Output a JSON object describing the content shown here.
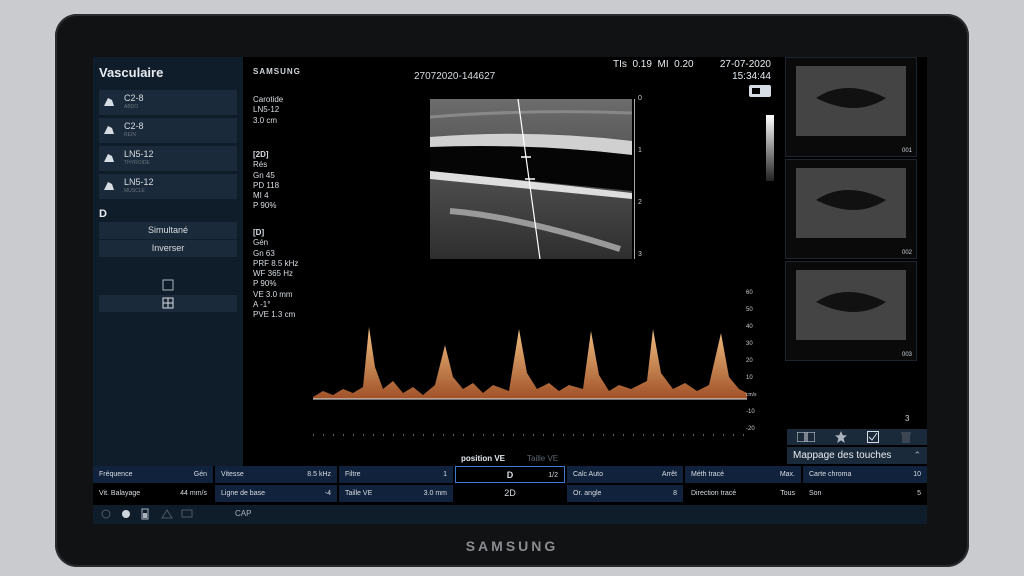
{
  "bezel_brand": "SAMSUNG",
  "sidebar": {
    "title": "Vasculaire",
    "probes": [
      {
        "name": "C2-8",
        "sub": "ABDO"
      },
      {
        "name": "C2-8",
        "sub": "REIN"
      },
      {
        "name": "LN5-12",
        "sub": "THYROIDE"
      },
      {
        "name": "LN5-12",
        "sub": "MUSCLE"
      }
    ],
    "section": "D",
    "buttons": [
      "Simultané",
      "Inverser"
    ]
  },
  "header": {
    "logo": "SAMSUNG",
    "study_id": "27072020-144627",
    "tis_label": "TIs",
    "tis_value": "0.19",
    "mi_label": "MI",
    "mi_value": "0.20",
    "date": "27-07-2020",
    "time": "15:34:44"
  },
  "params": {
    "exam": [
      "Carotide",
      "LN5-12",
      "3.0 cm"
    ],
    "mode2d_title": "[2D]",
    "mode2d_lines": [
      "Rés",
      "Gn   45",
      "PD   118",
      "MI   4",
      "P     90%"
    ],
    "modeD_title": "[D]",
    "modeD_lines": [
      "Gén",
      "Gn   63",
      "PRF  8.5 kHz",
      "WF   365 Hz",
      "P     90%",
      "VE   3.0 mm",
      "A     -1°",
      "PVE  1.3 cm"
    ]
  },
  "bmode_scale": [
    "0",
    "1",
    "2",
    "3"
  ],
  "doppler_scale": [
    "60",
    "50",
    "40",
    "30",
    "20",
    "10",
    "cm/s",
    "-10",
    "-20"
  ],
  "thumbnails": [
    "001",
    "002",
    "003"
  ],
  "thumb_count": "3",
  "mapping_label": "Mappage des touches",
  "tabs": {
    "active": "position VE",
    "inactive": "Taille VE"
  },
  "controls": {
    "row1": [
      {
        "label": "Fréquence",
        "value": "Gén"
      },
      {
        "label": "Vitesse",
        "value": "8.5 kHz"
      },
      {
        "label": "Filtre",
        "value": "1"
      },
      {
        "label": "D",
        "value": "1/2"
      },
      {
        "label": "Calc Auto",
        "value": "Arrêt"
      },
      {
        "label": "Méth tracé",
        "value": "Max."
      },
      {
        "label": "Carte chroma",
        "value": "10"
      }
    ],
    "row2": [
      {
        "label": "Vit. Balayage",
        "value": "44 mm/s"
      },
      {
        "label": "Ligne de base",
        "value": "-4"
      },
      {
        "label": "Taille VE",
        "value": "3.0 mm"
      },
      {
        "label": "2D",
        "value": ""
      },
      {
        "label": "Or. angle",
        "value": "8"
      },
      {
        "label": "Direction tracé",
        "value": "Tous"
      },
      {
        "label": "Son",
        "value": "5"
      }
    ]
  },
  "status": {
    "cap": "CAP"
  }
}
